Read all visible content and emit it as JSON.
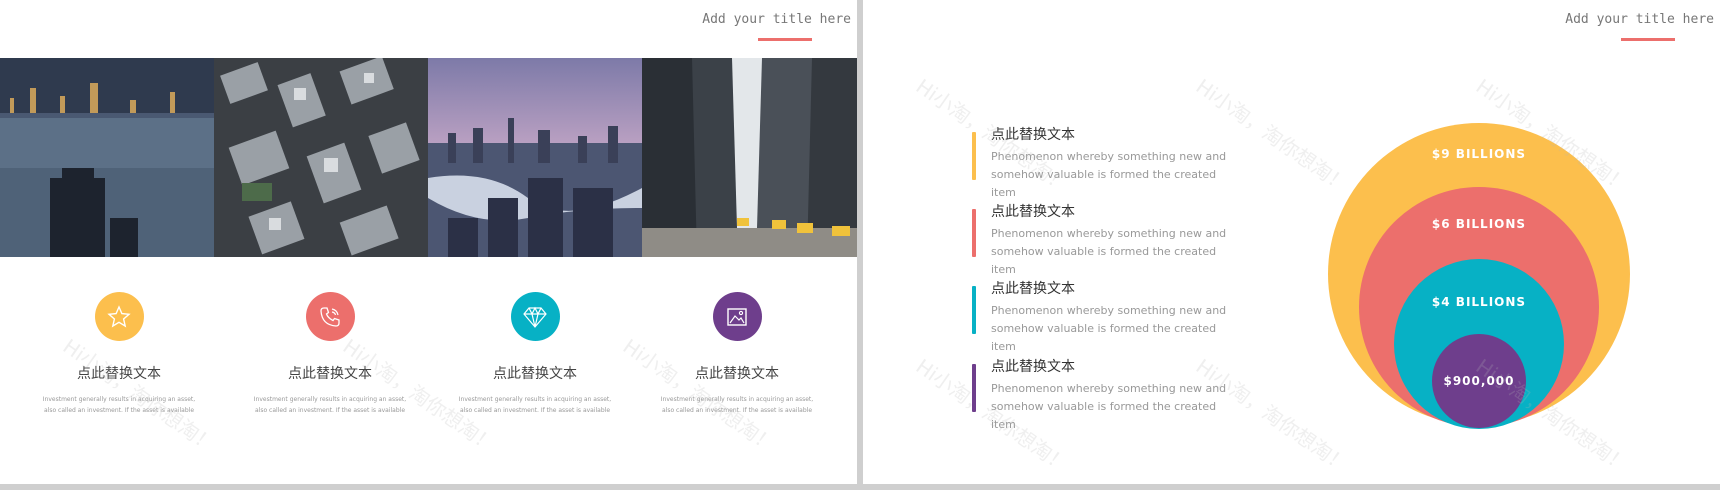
{
  "left_slide": {
    "title": "Add your title here",
    "photos": [
      "harbor-skyline-photo",
      "aerial-city-photo",
      "river-skyline-photo",
      "street-avenue-photo"
    ],
    "features": [
      {
        "icon": "star-icon",
        "color": "#fcbf4d",
        "title": "点此替换文本",
        "desc_line1": "Investment generally results in acquiring an asset,",
        "desc_line2": "also called an investment.  If the asset is available"
      },
      {
        "icon": "phone-icon",
        "color": "#ec6f6c",
        "title": "点此替换文本",
        "desc_line1": "Investment generally results in acquiring an asset,",
        "desc_line2": "also called an investment.  If the asset is available"
      },
      {
        "icon": "diamond-icon",
        "color": "#07b1c5",
        "title": "点此替换文本",
        "desc_line1": "Investment generally results in acquiring an asset,",
        "desc_line2": "also called an investment.  If the asset is available"
      },
      {
        "icon": "image-icon",
        "color": "#6e3e8c",
        "title": "点此替换文本",
        "desc_line1": "Investment generally results in acquiring an asset,",
        "desc_line2": "also called an investment.  If the asset is available"
      }
    ]
  },
  "right_slide": {
    "title": "Add your title here",
    "items": [
      {
        "color": "#fcbf4d",
        "title": "点此替换文本",
        "desc_line1": "Phenomenon whereby something new and",
        "desc_line2": "somehow valuable is formed the created item"
      },
      {
        "color": "#ec6f6c",
        "title": "点此替换文本",
        "desc_line1": "Phenomenon whereby something new and",
        "desc_line2": "somehow valuable is formed the created item"
      },
      {
        "color": "#07b1c5",
        "title": "点此替换文本",
        "desc_line1": "Phenomenon whereby something new and",
        "desc_line2": "somehow valuable is formed the created item"
      },
      {
        "color": "#6e3e8c",
        "title": "点此替换文本",
        "desc_line1": "Phenomenon whereby something new and",
        "desc_line2": "somehow valuable is formed the created item"
      }
    ],
    "circles": [
      {
        "label": "$9 BILLIONS",
        "color": "#fcbf4d"
      },
      {
        "label": "$6 BILLIONS",
        "color": "#ec6f6c"
      },
      {
        "label": "$4 BILLIONS",
        "color": "#07b1c5"
      },
      {
        "label": "$900,000",
        "color": "#6e3e8c"
      }
    ]
  },
  "watermark_text": "Hi小淘，淘你想淘！",
  "colors": {
    "accent_red": "#ec6f6c",
    "yellow": "#fcbf4d",
    "teal": "#07b1c5",
    "purple": "#6e3e8c"
  }
}
